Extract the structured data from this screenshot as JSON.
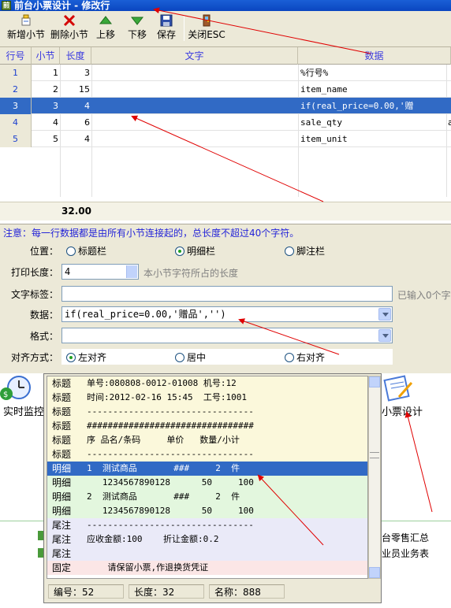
{
  "window": {
    "title": "前台小票设计 - 修改行"
  },
  "toolbar": {
    "add_label": "新增小节",
    "delete_label": "删除小节",
    "up_label": "上移",
    "down_label": "下移",
    "save_label": "保存",
    "close_label": "关闭ESC"
  },
  "grid": {
    "headers": [
      "行号",
      "小节",
      "长度",
      "文字",
      "数据"
    ],
    "rows": [
      {
        "row": "1",
        "section": "1",
        "length": "3",
        "text": "",
        "data": "%行号%"
      },
      {
        "row": "2",
        "section": "2",
        "length": "15",
        "text": "",
        "data": "item_name"
      },
      {
        "row": "3",
        "section": "3",
        "length": "4",
        "text": "",
        "data": "if(real_price=0.00,'赠品','')"
      },
      {
        "row": "4",
        "section": "4",
        "length": "6",
        "text": "",
        "data": "sale_qty",
        "extra": "a"
      },
      {
        "row": "5",
        "section": "5",
        "length": "4",
        "text": "",
        "data": "item_unit"
      }
    ],
    "selected_row_index": 2,
    "total": "32.00"
  },
  "form": {
    "note": "注意：每一行数据都是由所有小节连接起的，总长度不超过40个字符。",
    "position_label": "位置：",
    "position_options": [
      "标题栏",
      "明细栏",
      "脚注栏"
    ],
    "position_selected": 1,
    "print_length_label": "打印长度：",
    "print_length_value": "4",
    "print_length_hint": "本小节字符所占的长度",
    "text_label_label": "文字标签：",
    "text_label_value": "",
    "text_label_hint": "已输入0个字",
    "data_label": "数据：",
    "data_value": "if(real_price=0.00,'赠品','')",
    "format_label": "格式：",
    "format_value": "",
    "align_label": "对齐方式：",
    "align_options": [
      "左对齐",
      "居中",
      "右对齐"
    ],
    "align_selected": 0
  },
  "desktop": {
    "realtime_label": "实时监控",
    "receipt_label": "小票设计",
    "retail_summary": "台零售汇总",
    "staff_business": "业员业务表"
  },
  "preview": {
    "rows": [
      {
        "tag": "标题",
        "text": "单号:080808-0012-01008 机号:12",
        "kind": "title"
      },
      {
        "tag": "标题",
        "text": "时间:2012-02-16 15:45  工号:1001",
        "kind": "title"
      },
      {
        "tag": "标题",
        "text": "--------------------------------",
        "kind": "title"
      },
      {
        "tag": "标题",
        "text": "################################",
        "kind": "title"
      },
      {
        "tag": "标题",
        "text": "序 品名/条码     单价   数量/小计",
        "kind": "title"
      },
      {
        "tag": "标题",
        "text": "--------------------------------",
        "kind": "title"
      },
      {
        "tag": "明细",
        "text": "1  测试商品       ###     2  件",
        "kind": "sel"
      },
      {
        "tag": "明细",
        "text": "   1234567890128      50     100",
        "kind": "detail"
      },
      {
        "tag": "明细",
        "text": "2  测试商品       ###     2  件",
        "kind": "detail"
      },
      {
        "tag": "明细",
        "text": "   1234567890128      50     100",
        "kind": "detail"
      },
      {
        "tag": "尾注",
        "text": "--------------------------------",
        "kind": "footer"
      },
      {
        "tag": "尾注",
        "text": "应收金额:100    折让金额:0.2",
        "kind": "footer"
      },
      {
        "tag": "尾注",
        "text": "",
        "kind": "footer"
      },
      {
        "tag": "固定",
        "text": "    请保留小票,作退换货凭证",
        "kind": "fixed"
      }
    ],
    "status_number": "编号：52",
    "status_length": "长度：32",
    "status_name": "名称：888"
  },
  "colors": {
    "selection": "#316ac5",
    "titlebar": "#0a46c0",
    "note_text": "#2424d8",
    "annotation": "#e00000"
  }
}
